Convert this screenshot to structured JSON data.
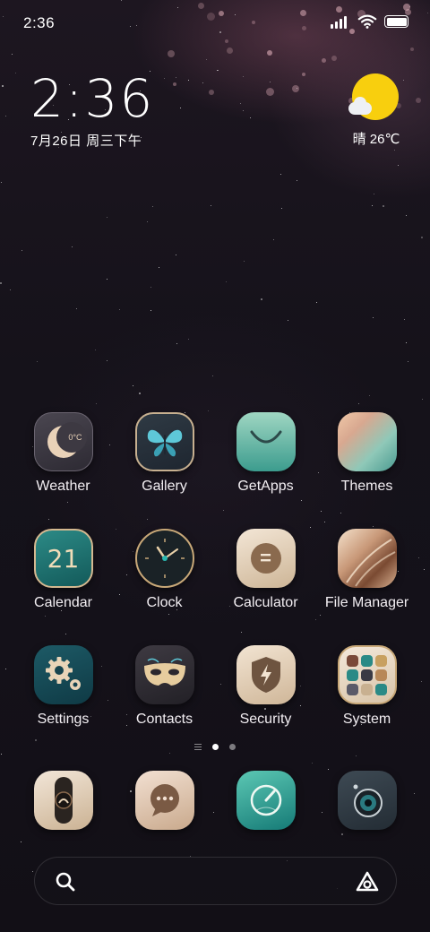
{
  "status_bar": {
    "time": "2:36",
    "icons": [
      "signal-icon",
      "wifi-icon",
      "battery-icon"
    ]
  },
  "clock_widget": {
    "time": "2:36",
    "date": "7月26日 周三下午"
  },
  "weather_widget": {
    "icon": "sun-cloud-icon",
    "text": "晴 26℃"
  },
  "apps": [
    {
      "label": "Weather",
      "icon": "weather-icon"
    },
    {
      "label": "Gallery",
      "icon": "gallery-icon"
    },
    {
      "label": "GetApps",
      "icon": "getapps-icon"
    },
    {
      "label": "Themes",
      "icon": "themes-icon"
    },
    {
      "label": "Calendar",
      "icon": "calendar-icon",
      "icon_text": "21"
    },
    {
      "label": "Clock",
      "icon": "clock-icon"
    },
    {
      "label": "Calculator",
      "icon": "calculator-icon",
      "icon_text": "="
    },
    {
      "label": "File Manager",
      "icon": "file-manager-icon"
    },
    {
      "label": "Settings",
      "icon": "settings-icon"
    },
    {
      "label": "Contacts",
      "icon": "contacts-icon"
    },
    {
      "label": "Security",
      "icon": "security-icon"
    },
    {
      "label": "System",
      "icon": "system-icon"
    }
  ],
  "weather_icon_text": "0°C",
  "page_indicator": {
    "pages": 2,
    "active": 1
  },
  "dock": [
    {
      "icon": "phone-icon"
    },
    {
      "icon": "messages-icon"
    },
    {
      "icon": "browser-icon"
    },
    {
      "icon": "camera-icon"
    }
  ],
  "search_bar": {
    "left_icon": "search-icon",
    "right_icon": "assistant-icon"
  },
  "colors": {
    "sun": "#f8cf0e",
    "accent_gold": "#c8a878",
    "teal": "#2c8a86"
  }
}
